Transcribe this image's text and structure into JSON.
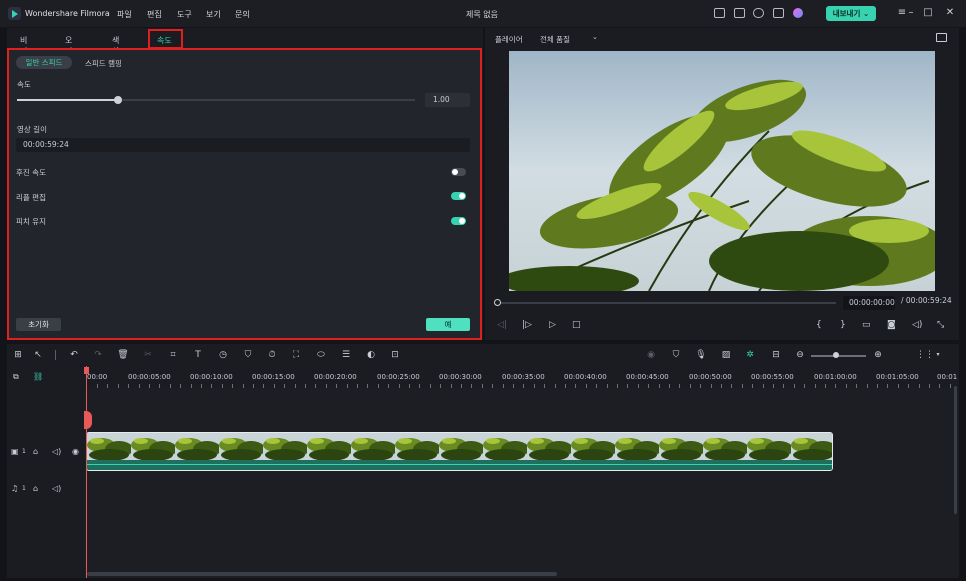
{
  "titlebar": {
    "app_name": "Wondershare Filmora",
    "menu": [
      "파일",
      "편집",
      "도구",
      "보기",
      "문의"
    ],
    "document_title": "제목 없음",
    "export_label": "내보내기 ⌄"
  },
  "edit_panel": {
    "tabs": [
      "비디오",
      "오디오",
      "색상",
      "속도"
    ],
    "active_tab": "속도",
    "speed_modes": [
      "일반 스피드",
      "스피드 램핑"
    ],
    "speed_label": "속도",
    "speed_value": "1.00",
    "speed_fraction": 0.25,
    "duration_label": "영상 길이",
    "duration_value": "00:00:59:24",
    "toggles": [
      {
        "label": "후진 속도",
        "on": false
      },
      {
        "label": "리플 편집",
        "on": true
      },
      {
        "label": "피치 유지",
        "on": true
      }
    ],
    "reset_label": "초기화",
    "ok_label": "예"
  },
  "player": {
    "label": "플레이어",
    "quality": "전체 품질",
    "current_time": "00:00:00:00",
    "total_time": "/ 00:00:59:24"
  },
  "timeline": {
    "ruler": [
      "00:00",
      "00:00:05:00",
      "00:00:10:00",
      "00:00:15:00",
      "00:00:20:00",
      "00:00:25:00",
      "00:00:30:00",
      "00:00:35:00",
      "00:00:40:00",
      "00:00:45:00",
      "00:00:50:00",
      "00:00:55:00",
      "00:01:00:00",
      "00:01:05:00",
      "00:01"
    ],
    "video_track_num": "1",
    "audio_track_num": "1"
  }
}
